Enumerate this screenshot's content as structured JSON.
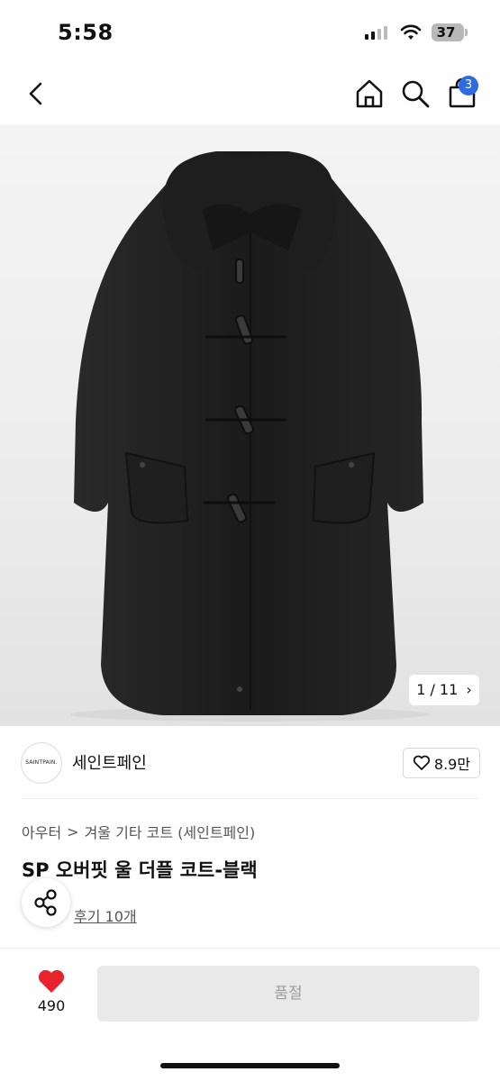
{
  "status_bar": {
    "time": "5:58",
    "battery": "37"
  },
  "nav": {
    "cart_count": "3"
  },
  "gallery": {
    "current": "1",
    "total": "11",
    "counter_text": "1 / 11"
  },
  "brand": {
    "logo_text": "SAINTPAIN.",
    "name": "세인트페인",
    "likes": "8.9만"
  },
  "breadcrumb": {
    "level1": "아우터",
    "separator": ">",
    "level2": "겨울 기타 코트 (세인트페인)"
  },
  "product": {
    "title": "SP 오버핏 울 더플 코트-블랙",
    "reviews": "후기 10개"
  },
  "bottom": {
    "wish_count": "490",
    "buy_label": "품절"
  },
  "colors": {
    "accent": "#2d6ae3",
    "heart": "#e8232e",
    "soldout_bg": "#e9e9e9"
  },
  "icons": [
    "chevron-left-icon",
    "home-icon",
    "search-icon",
    "shopping-bag-icon",
    "heart-outline-icon",
    "share-icon",
    "heart-filled-icon"
  ]
}
